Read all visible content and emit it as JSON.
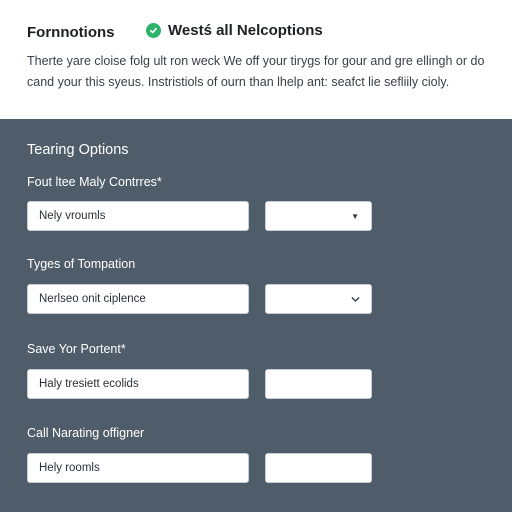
{
  "header": {
    "app_title": "Fornnotions",
    "badge": {
      "icon": "check-circle-icon",
      "label": "Westś all Nelcoptions"
    },
    "description_lines": [
      "Therte yare cloise folg ult ron weck We off your tirygs for gour and gre ellingh or do",
      "cand your this syeus. Instristiols of ourn than lhelp ant: seafct lie sefliily cioly."
    ]
  },
  "panel": {
    "title": "Tearing Options",
    "groups": [
      {
        "label": "Fout ltee Maly Contrres*",
        "field_value": "Nely vroumls",
        "select": {
          "value": "",
          "indicator": "small-caret-icon"
        }
      },
      {
        "label": "Tyges of Tompation",
        "field_value": "Nerlseo onit ciplence",
        "select": {
          "value": "",
          "indicator": "chevron-down-icon"
        }
      },
      {
        "label": "Save Yor Portent*",
        "field_value": "Haly tresiett ecolids",
        "select": {
          "value": "",
          "indicator": ""
        }
      },
      {
        "label": "Call Narating offigner",
        "field_value": "Hely roomls",
        "select": {
          "value": "",
          "indicator": ""
        }
      }
    ]
  },
  "colors": {
    "panel_bg": "#4f5c69",
    "accent_green": "#2fb36a",
    "header_bg": "#ffffff"
  }
}
